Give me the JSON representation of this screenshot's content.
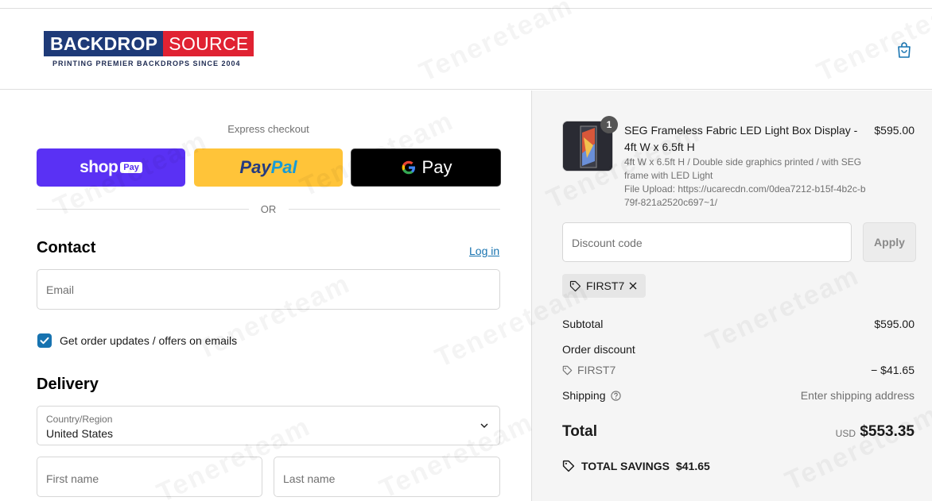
{
  "header": {
    "logo_left": "BACKDROP",
    "logo_right": "SOURCE",
    "tagline": "PRINTING PREMIER BACKDROPS SINCE 2004",
    "cart_icon": "shopping-bag-icon"
  },
  "express": {
    "label": "Express checkout",
    "shop_text": "shop",
    "shop_badge": "Pay",
    "paypal_1": "Pay",
    "paypal_2": "Pal",
    "gpay_g": "G",
    "gpay_text": "Pay",
    "or": "OR"
  },
  "contact": {
    "title": "Contact",
    "login": "Log in",
    "email_placeholder": "Email",
    "checkbox_label": "Get order updates / offers on emails",
    "checkbox_checked": true
  },
  "delivery": {
    "title": "Delivery",
    "country_label": "Country/Region",
    "country_value": "United States",
    "first_name_placeholder": "First name",
    "last_name_placeholder": "Last name"
  },
  "summary": {
    "quantity": "1",
    "product_title": "SEG Frameless Fabric LED Light Box Display - 4ft W x 6.5ft H",
    "product_variant": "4ft W x 6.5ft H / Double side graphics printed / with SEG frame with LED Light",
    "product_file": "File Upload: https://ucarecdn.com/0dea7212-b15f-4b2c-b79f-821a2520c697~1/",
    "product_price": "$595.00",
    "discount_placeholder": "Discount code",
    "apply_label": "Apply",
    "applied_code": "FIRST7",
    "subtotal_label": "Subtotal",
    "subtotal_value": "$595.00",
    "order_discount_label": "Order discount",
    "discount_code": "FIRST7",
    "discount_value": "− $41.65",
    "shipping_label": "Shipping",
    "shipping_value": "Enter shipping address",
    "total_label": "Total",
    "currency": "USD",
    "total_value": "$553.35",
    "savings_label": "TOTAL SAVINGS",
    "savings_value": "$41.65"
  },
  "watermark": "Tenereteam",
  "colors": {
    "shop_pay": "#5a31f4",
    "paypal": "#ffc439",
    "gpay": "#000000",
    "link": "#1773b0",
    "logo_blue": "#1e3a78",
    "logo_red": "#e02232"
  }
}
